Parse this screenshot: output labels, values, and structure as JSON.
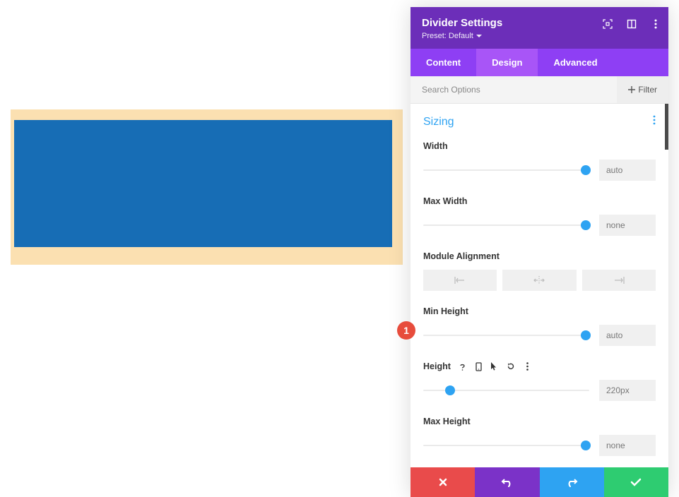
{
  "canvas": {
    "bg": "#fbe0b1",
    "divider_color": "#176db5"
  },
  "panel": {
    "title": "Divider Settings",
    "preset_label": "Preset: Default"
  },
  "tabs": {
    "content": "Content",
    "design": "Design",
    "advanced": "Advanced"
  },
  "search": {
    "placeholder": "Search Options",
    "filter": "Filter"
  },
  "section": {
    "title": "Sizing"
  },
  "fields": {
    "width": {
      "label": "Width",
      "value": "auto",
      "thumb_pct": 95
    },
    "max_width": {
      "label": "Max Width",
      "value": "none",
      "thumb_pct": 95
    },
    "alignment": {
      "label": "Module Alignment"
    },
    "min_height": {
      "label": "Min Height",
      "value": "auto",
      "thumb_pct": 95
    },
    "height": {
      "label": "Height",
      "value": "220px",
      "thumb_pct": 13
    },
    "max_height": {
      "label": "Max Height",
      "value": "none",
      "thumb_pct": 95
    }
  },
  "annotation": {
    "num": "1"
  }
}
